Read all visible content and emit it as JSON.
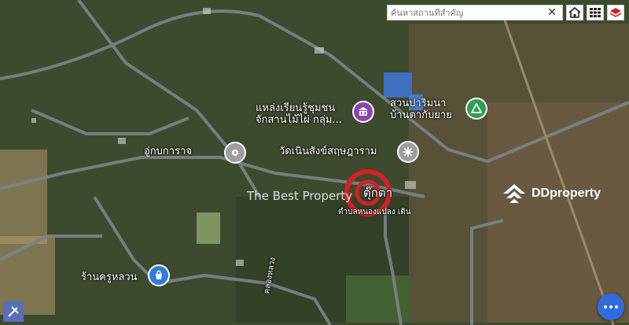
{
  "search": {
    "placeholder": "ค้นหาสถานที่สำคัญ",
    "clear_glyph": "✕"
  },
  "toolbar": {
    "icons": [
      "home-icon",
      "grid-icon",
      "layers-icon"
    ]
  },
  "places": [
    {
      "name": "แหล่งเรียนรู้ชุมชนจักสานไม้ไผ่ กลุ่ม...",
      "line1": "แหล่งเรียนรู้ชุมชน",
      "line2": "จักสานไม้ไผ่ กลุ่ม...",
      "icon": "museum-icon",
      "color": "#8e44ad"
    },
    {
      "name": "สวนปาริมนา บ้านตากับยาย",
      "line1": "สวนปาริมนา",
      "line2": "บ้านตากับยาย",
      "icon": "park-icon",
      "color": "#2e9e4f"
    },
    {
      "name": "อู่กบการาจ",
      "icon": "place-icon",
      "color": "#9e9e9e"
    },
    {
      "name": "วัดเนินสังข์สฤษฎาราม",
      "icon": "temple-icon",
      "color": "#9e9e9e"
    },
    {
      "name": "ร้านครูหลวน",
      "icon": "shop-icon",
      "color": "#2f7ed8"
    },
    {
      "name": "ตุ๊กตา",
      "icon": "target-icon",
      "color": "#d61f26"
    }
  ],
  "small_labels": {
    "under_target": "ตำบลหนองแปลง เดิน",
    "road": "คลองหลวง"
  },
  "watermark": "The Best Property",
  "brand": "DDproperty",
  "colors": {
    "target": "#d61f26",
    "fab": "#2e6ce0"
  }
}
